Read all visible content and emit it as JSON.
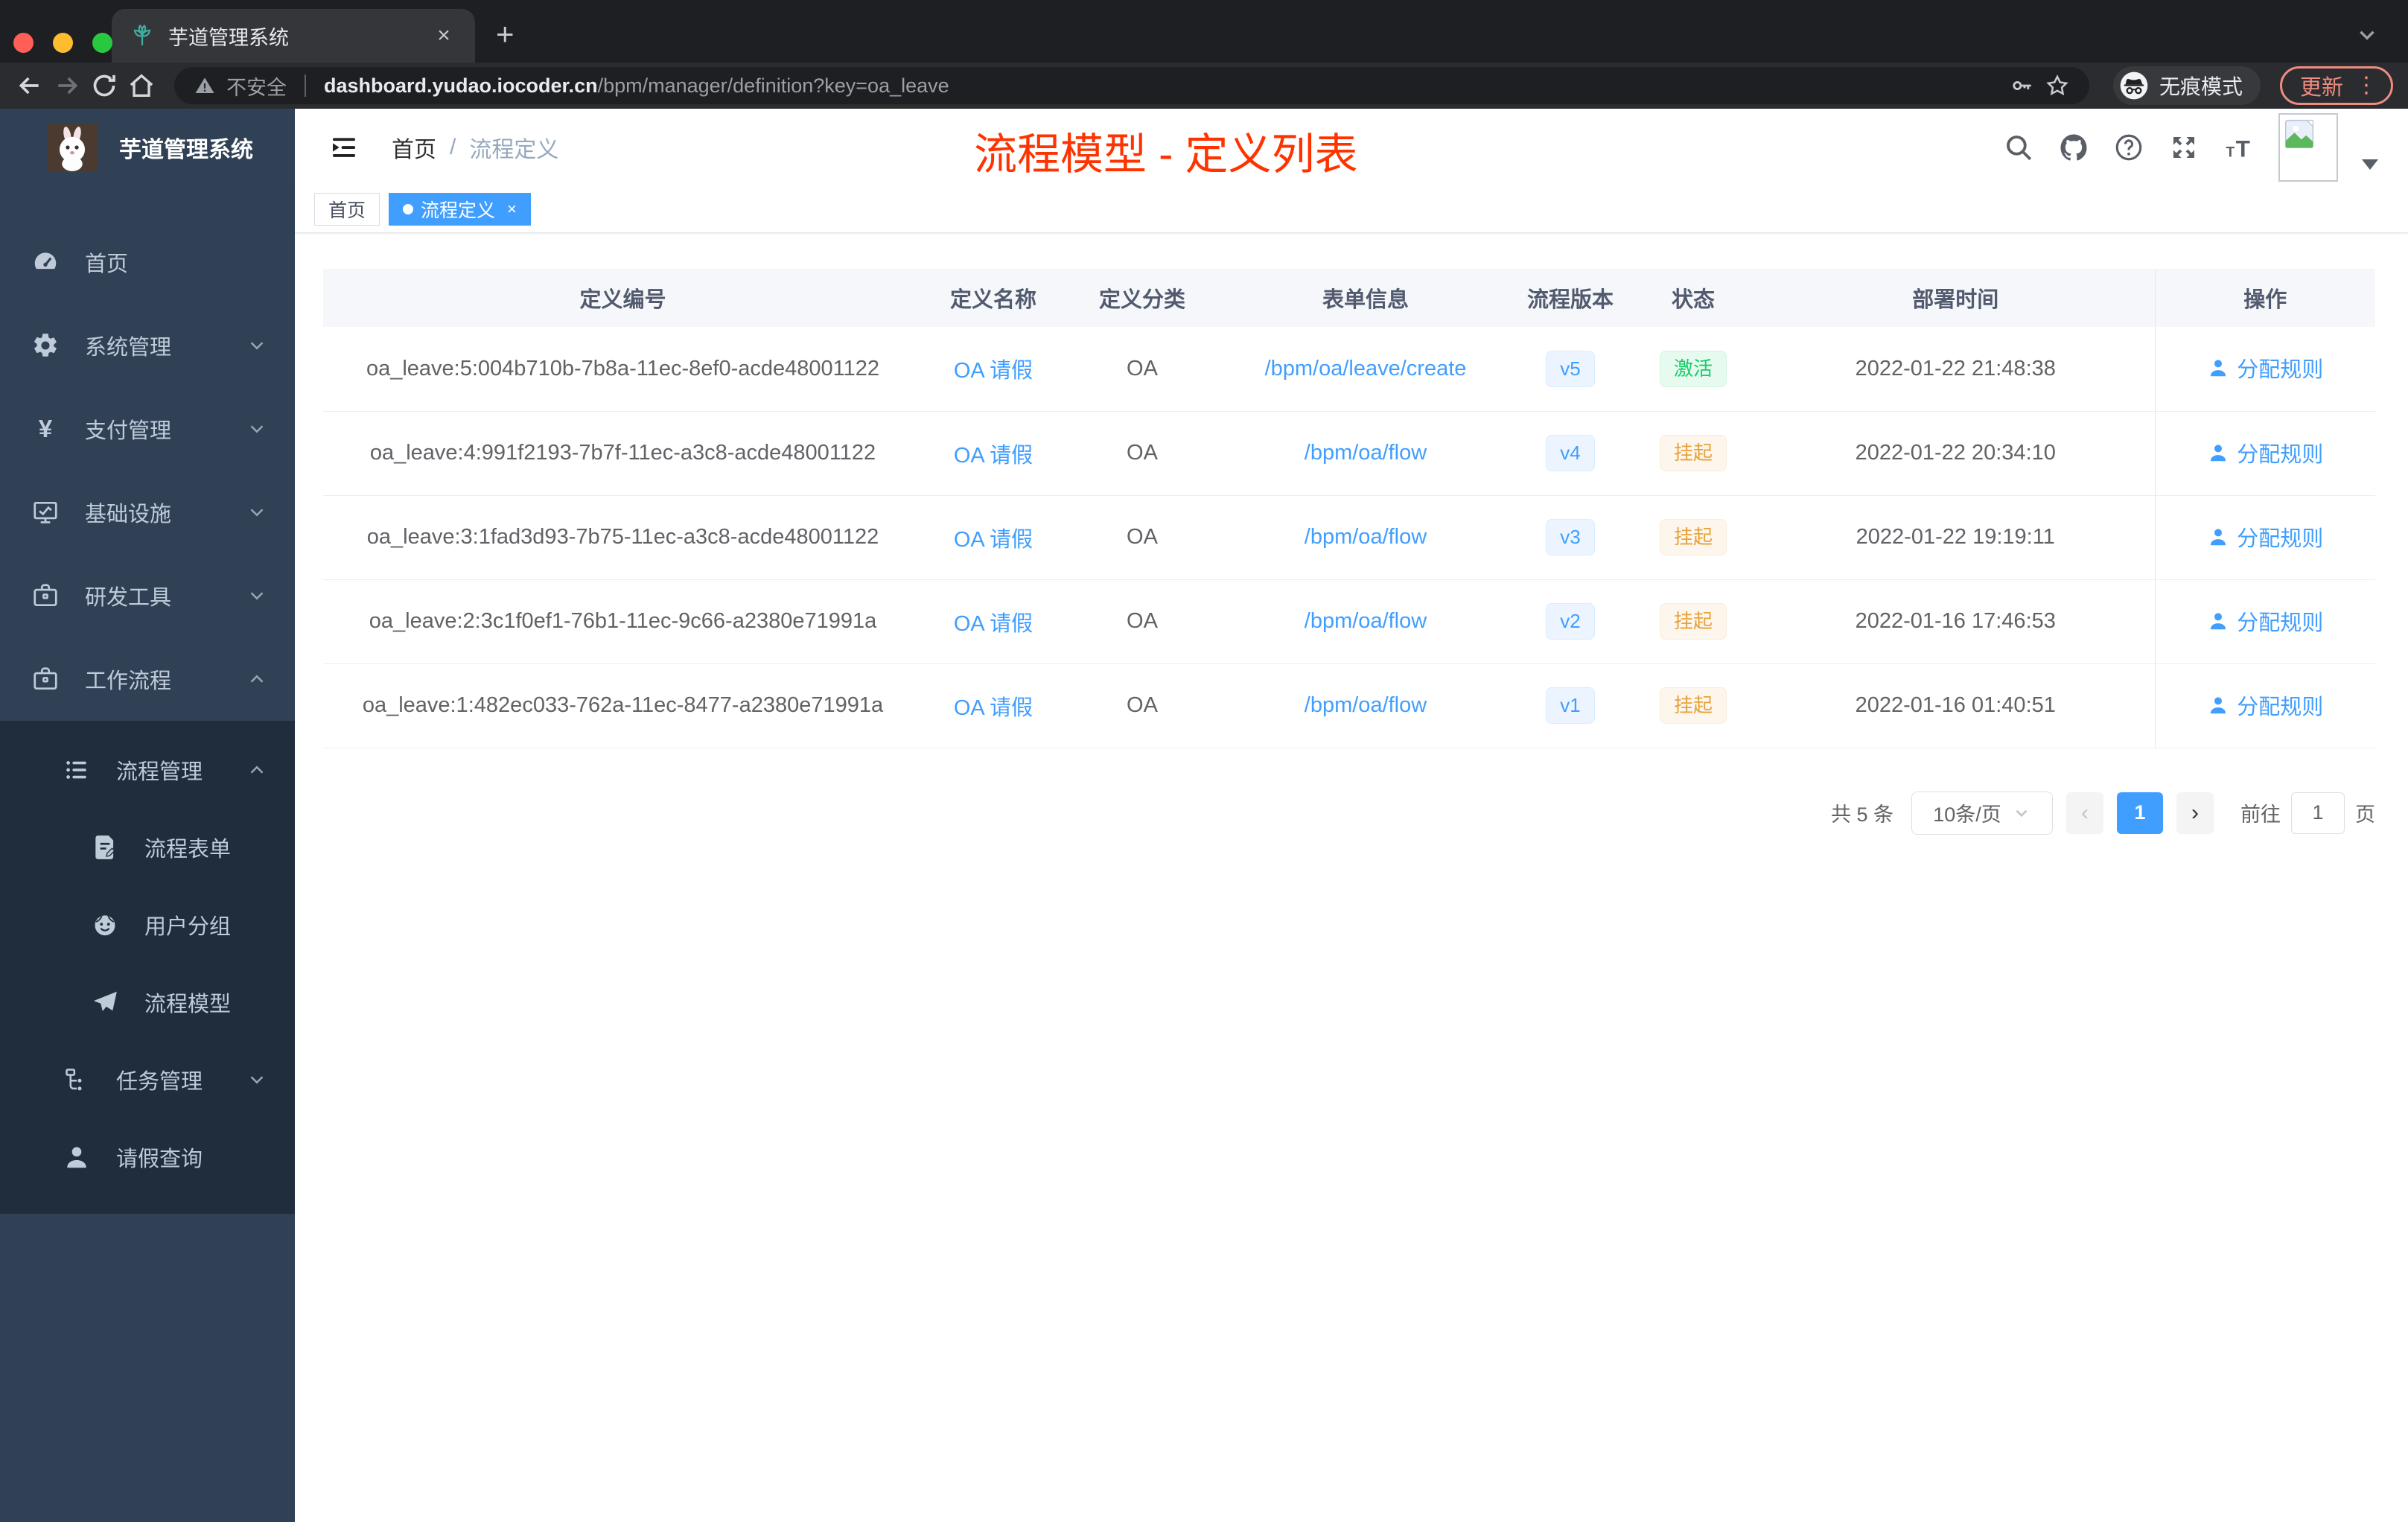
{
  "browser": {
    "tab_title": "芋道管理系统",
    "security_label": "不安全",
    "url_host": "dashboard.yudao.iocoder.cn",
    "url_path": "/bpm/manager/definition?key=oa_leave",
    "incognito_label": "无痕模式",
    "update_label": "更新"
  },
  "sidebar": {
    "title": "芋道管理系统",
    "menu": [
      {
        "label": "首页",
        "icon": "dashboard-icon",
        "level": 1,
        "group": "top"
      },
      {
        "label": "系统管理",
        "icon": "gear-icon",
        "level": 1,
        "group": "top",
        "chevron": "down"
      },
      {
        "label": "支付管理",
        "icon": "yen-icon",
        "level": 1,
        "group": "top",
        "chevron": "down"
      },
      {
        "label": "基础设施",
        "icon": "monitor-icon",
        "level": 1,
        "group": "top",
        "chevron": "down"
      },
      {
        "label": "研发工具",
        "icon": "briefcase-icon",
        "level": 1,
        "group": "top",
        "chevron": "down"
      },
      {
        "label": "工作流程",
        "icon": "briefcase-icon",
        "level": 1,
        "group": "top",
        "chevron": "up"
      },
      {
        "label": "流程管理",
        "icon": "list-icon",
        "level": 2,
        "group": "sub",
        "chevron": "up"
      },
      {
        "label": "流程表单",
        "icon": "form-icon",
        "level": 3,
        "group": "sub"
      },
      {
        "label": "用户分组",
        "icon": "user-group-icon",
        "level": 3,
        "group": "sub"
      },
      {
        "label": "流程模型",
        "icon": "paper-plane-icon",
        "level": 3,
        "group": "sub"
      },
      {
        "label": "任务管理",
        "icon": "tree-icon",
        "level": 2,
        "group": "sub",
        "chevron": "down"
      },
      {
        "label": "请假查询",
        "icon": "person-icon",
        "level": 2,
        "group": "sub"
      }
    ]
  },
  "header": {
    "breadcrumb": [
      "首页",
      "流程定义"
    ],
    "annotation": "流程模型 - 定义列表"
  },
  "tags": [
    {
      "label": "首页",
      "active": false,
      "closable": false
    },
    {
      "label": "流程定义",
      "active": true,
      "closable": true
    }
  ],
  "table": {
    "columns": [
      "定义编号",
      "定义名称",
      "定义分类",
      "表单信息",
      "流程版本",
      "状态",
      "部署时间",
      "操作"
    ],
    "rows": [
      {
        "id": "oa_leave:5:004b710b-7b8a-11ec-8ef0-acde48001122",
        "name": "OA 请假",
        "category": "OA",
        "form": "/bpm/oa/leave/create",
        "version": "v5",
        "status": "激活",
        "status_type": "success",
        "time": "2022-01-22 21:48:38",
        "action": "分配规则"
      },
      {
        "id": "oa_leave:4:991f2193-7b7f-11ec-a3c8-acde48001122",
        "name": "OA 请假",
        "category": "OA",
        "form": "/bpm/oa/flow",
        "version": "v4",
        "status": "挂起",
        "status_type": "warning",
        "time": "2022-01-22 20:34:10",
        "action": "分配规则"
      },
      {
        "id": "oa_leave:3:1fad3d93-7b75-11ec-a3c8-acde48001122",
        "name": "OA 请假",
        "category": "OA",
        "form": "/bpm/oa/flow",
        "version": "v3",
        "status": "挂起",
        "status_type": "warning",
        "time": "2022-01-22 19:19:11",
        "action": "分配规则"
      },
      {
        "id": "oa_leave:2:3c1f0ef1-76b1-11ec-9c66-a2380e71991a",
        "name": "OA 请假",
        "category": "OA",
        "form": "/bpm/oa/flow",
        "version": "v2",
        "status": "挂起",
        "status_type": "warning",
        "time": "2022-01-16 17:46:53",
        "action": "分配规则"
      },
      {
        "id": "oa_leave:1:482ec033-762a-11ec-8477-a2380e71991a",
        "name": "OA 请假",
        "category": "OA",
        "form": "/bpm/oa/flow",
        "version": "v1",
        "status": "挂起",
        "status_type": "warning",
        "time": "2022-01-16 01:40:51",
        "action": "分配规则"
      }
    ]
  },
  "pagination": {
    "total": "共 5 条",
    "page_size": "10条/页",
    "current": "1",
    "goto_label": "前往",
    "goto_value": "1",
    "page_label": "页"
  },
  "colors": {
    "accent": "#409EFF",
    "annotation_red": "#FF3300",
    "success": "#13CE66",
    "warning": "#E6A23C",
    "sidebar_bg": "#304156",
    "submenu_bg": "#1F2D3D"
  }
}
